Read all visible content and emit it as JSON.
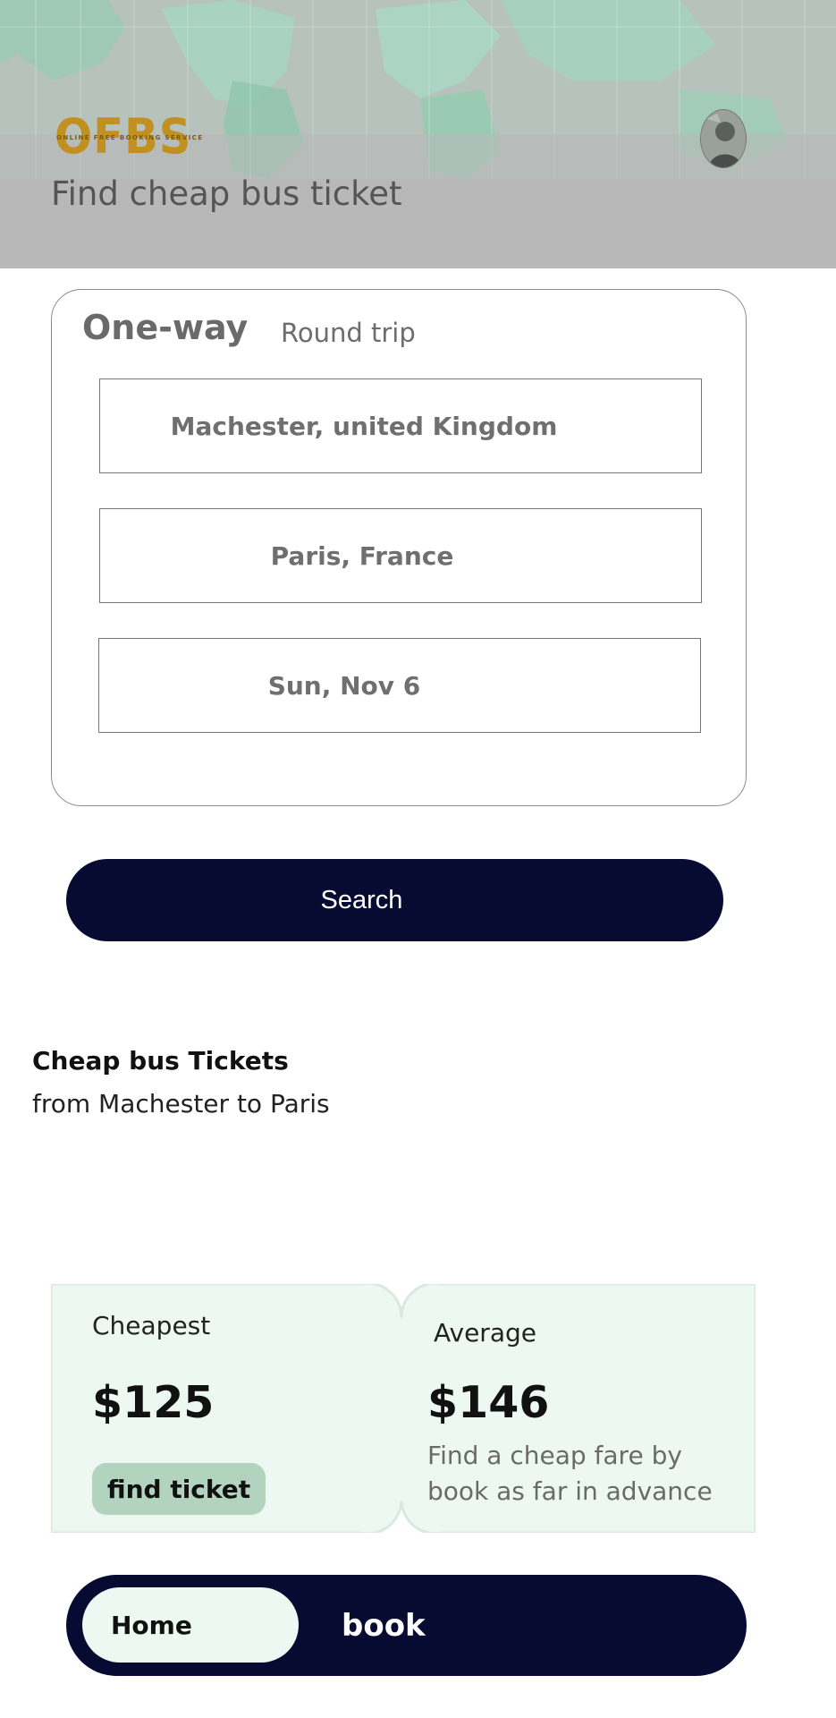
{
  "header": {
    "logo": {
      "letters": "OFBS",
      "tagline": "ONLINE FREE BOOKING SERVICE"
    },
    "tagline": "Find cheap bus ticket",
    "avatar_icon": "user-avatar"
  },
  "search_form": {
    "tabs": {
      "one_way": "One-way",
      "round_trip": "Round trip"
    },
    "from_value": "Machester, united Kingdom",
    "to_value": "Paris, France",
    "date_value": "Sun, Nov 6",
    "search_button": "Search"
  },
  "results": {
    "title": "Cheap bus Tickets",
    "subtitle": "from Machester to Paris"
  },
  "prices": {
    "cheapest": {
      "label": "Cheapest",
      "value": "$125",
      "button": "find ticket"
    },
    "average": {
      "label": "Average",
      "value": "$146",
      "note": "Find a cheap fare by book as far in advance"
    }
  },
  "bottom_nav": {
    "home": "Home",
    "book": "book"
  },
  "colors": {
    "navy": "#070b32",
    "header_gray": "#b8b8b8",
    "logo_gold": "#c29020",
    "ticket_bg": "#eef8f3",
    "find_button": "#b2d4be"
  }
}
